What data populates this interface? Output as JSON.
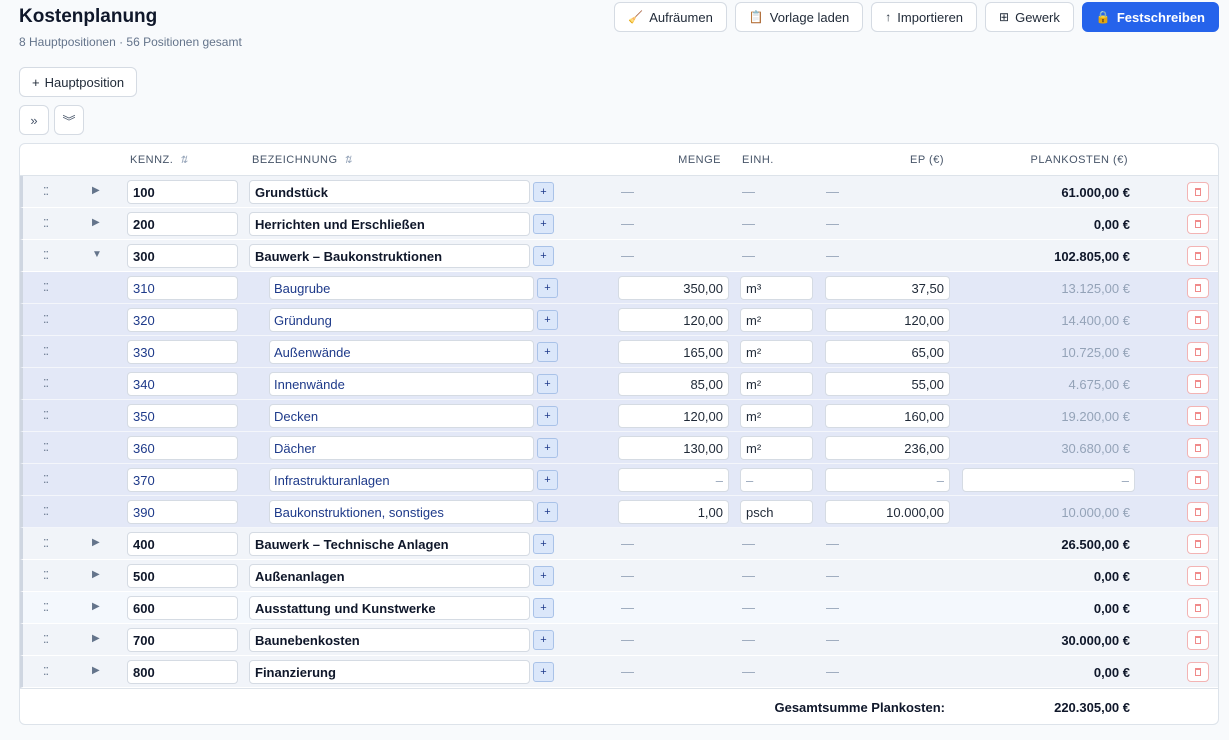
{
  "page": {
    "title": "Kostenplanung",
    "subtitle": "8 Hauptpositionen · 56 Positionen gesamt"
  },
  "toolbar": {
    "cleanup": "Aufräumen",
    "load_template": "Vorlage laden",
    "import": "Importieren",
    "trade": "Gewerk",
    "commit": "Festschreiben"
  },
  "add_main_label": "Hauptposition",
  "columns": {
    "code": "KENNZ.",
    "name": "BEZEICHNUNG",
    "qty": "MENGE",
    "unit": "EINH.",
    "unit_price": "EP (€)",
    "planned_cost": "PLANKOSTEN (€)"
  },
  "placeholder_dash": "—",
  "rows": [
    {
      "type": "main",
      "code": "100",
      "name": "Grundstück",
      "cost": "61.000,00 €",
      "expanded": false
    },
    {
      "type": "main",
      "code": "200",
      "name": "Herrichten und Erschließen",
      "cost": "0,00 €",
      "expanded": false
    },
    {
      "type": "main",
      "code": "300",
      "name": "Bauwerk – Baukonstruktionen",
      "cost": "102.805,00 €",
      "expanded": true
    },
    {
      "type": "sub",
      "code": "310",
      "name": "Baugrube",
      "qty": "350,00",
      "unit": "m³",
      "ep": "37,50",
      "cost": "13.125,00 €"
    },
    {
      "type": "sub",
      "code": "320",
      "name": "Gründung",
      "qty": "120,00",
      "unit": "m²",
      "ep": "120,00",
      "cost": "14.400,00 €"
    },
    {
      "type": "sub",
      "code": "330",
      "name": "Außenwände",
      "qty": "165,00",
      "unit": "m²",
      "ep": "65,00",
      "cost": "10.725,00 €"
    },
    {
      "type": "sub",
      "code": "340",
      "name": "Innenwände",
      "qty": "85,00",
      "unit": "m²",
      "ep": "55,00",
      "cost": "4.675,00 €"
    },
    {
      "type": "sub",
      "code": "350",
      "name": "Decken",
      "qty": "120,00",
      "unit": "m²",
      "ep": "160,00",
      "cost": "19.200,00 €"
    },
    {
      "type": "sub",
      "code": "360",
      "name": "Dächer",
      "qty": "130,00",
      "unit": "m²",
      "ep": "236,00",
      "cost": "30.680,00 €"
    },
    {
      "type": "sub_empty",
      "code": "370",
      "name": "Infrastrukturanlagen",
      "qty_ph": "–",
      "unit_ph": "–",
      "ep_ph": "–",
      "cost_ph": "–"
    },
    {
      "type": "sub",
      "code": "390",
      "name": "Baukonstruktionen, sonstiges",
      "qty": "1,00",
      "unit": "psch",
      "ep": "10.000,00",
      "cost": "10.000,00 €"
    },
    {
      "type": "main",
      "code": "400",
      "name": "Bauwerk – Technische Anlagen",
      "cost": "26.500,00 €",
      "expanded": false
    },
    {
      "type": "main",
      "code": "500",
      "name": "Außenanlagen",
      "cost": "0,00 €",
      "expanded": false
    },
    {
      "type": "main",
      "code": "600",
      "name": "Ausstattung und Kunstwerke",
      "cost": "0,00 €",
      "expanded": false
    },
    {
      "type": "main",
      "code": "700",
      "name": "Baunebenkosten",
      "cost": "30.000,00 €",
      "expanded": false
    },
    {
      "type": "main",
      "code": "800",
      "name": "Finanzierung",
      "cost": "0,00 €",
      "expanded": false
    }
  ],
  "footer": {
    "label": "Gesamtsumme Plankosten:",
    "total": "220.305,00 €"
  }
}
